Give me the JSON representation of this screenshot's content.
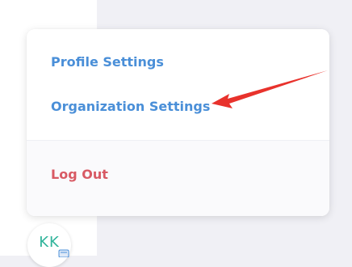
{
  "menu": {
    "profile_label": "Profile Settings",
    "organization_label": "Organization Settings",
    "logout_label": "Log Out"
  },
  "avatar": {
    "initials": "KK"
  },
  "annotation": {
    "arrow_color": "#e8322c"
  },
  "colors": {
    "link_blue": "#4a8fd8",
    "logout_red": "#d85a64",
    "avatar_teal": "#2fb39a"
  }
}
